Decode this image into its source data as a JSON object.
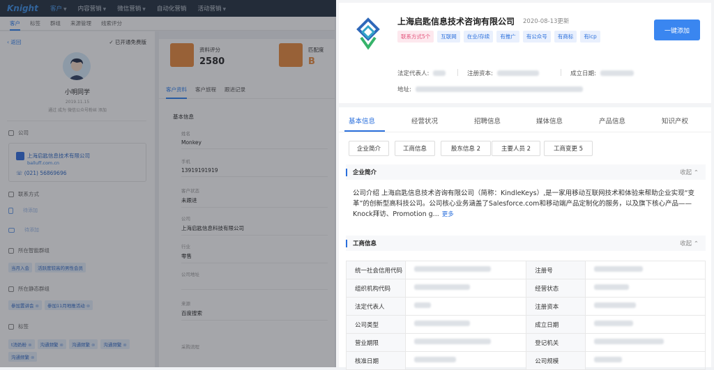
{
  "app": {
    "logo": "Knight"
  },
  "nav": {
    "items": [
      {
        "label": "客户",
        "active": true
      },
      {
        "label": "内容营销"
      },
      {
        "label": "微信营销"
      },
      {
        "label": "自动化营销"
      },
      {
        "label": "活动营销"
      }
    ]
  },
  "subtabs": [
    "客户",
    "标签",
    "群组",
    "来源管理",
    "线索评分"
  ],
  "left": {
    "back": "返回",
    "free_toggle": "已开通免费版",
    "name": "小明同学",
    "date": "2019.11.15",
    "note": "通过 成为 微信公众号粉丝 添加",
    "company_section": "公司",
    "company_name": "上海启匙信息技术有限公司",
    "company_site": "balluff.com.cn",
    "company_phone": "(021) 56869696",
    "contact_section": "联系方式",
    "phone_placeholder": "待添加",
    "email_placeholder": "待添加",
    "smart_group_section": "所在智能群组",
    "smart_groups": [
      "当月入会",
      "活跃度较高的男性会员"
    ],
    "static_group_section": "所在静态群组",
    "static_groups": [
      "参加置讲会",
      "参加11月地推活动"
    ],
    "tag_section": "标签",
    "tags": [
      "t消奶粉",
      "沟通频繁",
      "沟通频繁",
      "沟通频繁",
      "沟通频繁"
    ]
  },
  "score": {
    "label1": "资料评分",
    "value1": "2580",
    "label2": "匹配度",
    "value2": "B"
  },
  "mid": {
    "tabs": [
      "客户资料",
      "客户旅程",
      "跟进记录"
    ],
    "section": "基本信息",
    "fields": [
      {
        "label": "姓名",
        "value": "Monkey"
      },
      {
        "label": "手机",
        "value": "13919191919"
      },
      {
        "label": "客户状态",
        "value": "未跟进"
      },
      {
        "label": "公司",
        "value": "上海启匙信息科技有限公司"
      },
      {
        "label": "行业",
        "value": "零售"
      },
      {
        "label": "公司地址",
        "value": ""
      },
      {
        "label": "来源",
        "value": "百度搜索"
      },
      {
        "label": "采购流程",
        "value": ""
      }
    ]
  },
  "company": {
    "name": "上海启匙信息技术咨询有限公司",
    "updated": "2020-08-13更新",
    "badges": [
      "联系方式5个",
      "互联网",
      "在业/存续",
      "有推广",
      "有公众号",
      "有商标",
      "有icp"
    ],
    "add_button": "一键添加",
    "legal_rep_label": "法定代表人:",
    "capital_label": "注册资本:",
    "founded_label": "成立日期:",
    "address_label": "地址:",
    "colors": {
      "accent": "#3a86f0",
      "pink": "#e2527a"
    }
  },
  "tabs": [
    "基本信息",
    "经营状况",
    "招聘信息",
    "媒体信息",
    "产品信息",
    "知识产权"
  ],
  "subbuttons": [
    "企业简介",
    "工商信息",
    "股东信息 2",
    "主要人员 2",
    "工商变更 5"
  ],
  "intro": {
    "title": "企业简介",
    "collapse": "收起",
    "text": "公司介绍 上海启匙信息技术咨询有限公司（简称：KindleKeys）,是一家用移动互联网技术和体验来帮助企业实现“变革”的创新型高科技公司。公司核心业务涵盖了Salesforce.com和移动端产品定制化的服务，以及旗下核心产品——Knock拜访、Promotion g...",
    "more": "更多"
  },
  "biz": {
    "title": "工商信息",
    "collapse": "收起",
    "rows": [
      [
        "统一社会信用代码",
        "注册号"
      ],
      [
        "组织机构代码",
        "经营状态"
      ],
      [
        "法定代表人",
        "注册资本"
      ],
      [
        "公司类型",
        "成立日期"
      ],
      [
        "营业期限",
        "登记机关"
      ],
      [
        "核准日期",
        "公司规模"
      ]
    ]
  }
}
